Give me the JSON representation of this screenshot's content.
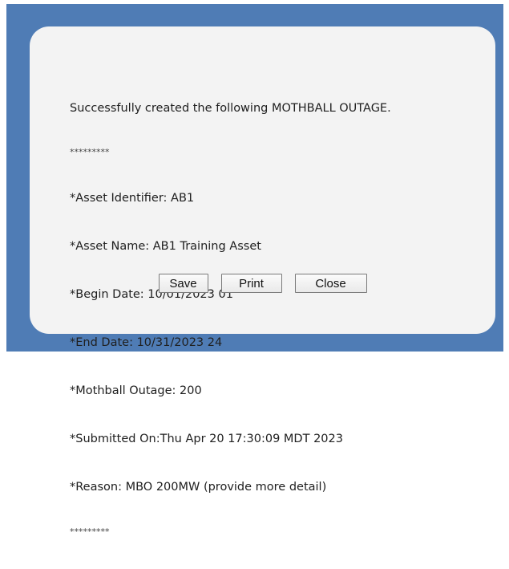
{
  "message": {
    "heading": "Successfully created the following MOTHBALL OUTAGE.",
    "separator_top": "*********",
    "lines": [
      "*Asset Identifier: AB1",
      "*Asset Name: AB1 Training Asset",
      "*Begin Date: 10/01/2023 01",
      "*End Date: 10/31/2023 24",
      "*Mothball Outage: 200",
      "*Submitted On:Thu Apr 20 17:30:09 MDT 2023",
      "*Reason: MBO 200MW (provide more detail)"
    ],
    "separator_bottom": "*********"
  },
  "buttons": {
    "save_label": "Save",
    "print_label": "Print",
    "close_label": "Close"
  },
  "colors": {
    "backdrop": "#4f7cb5",
    "dialog": "#f3f3f3"
  }
}
